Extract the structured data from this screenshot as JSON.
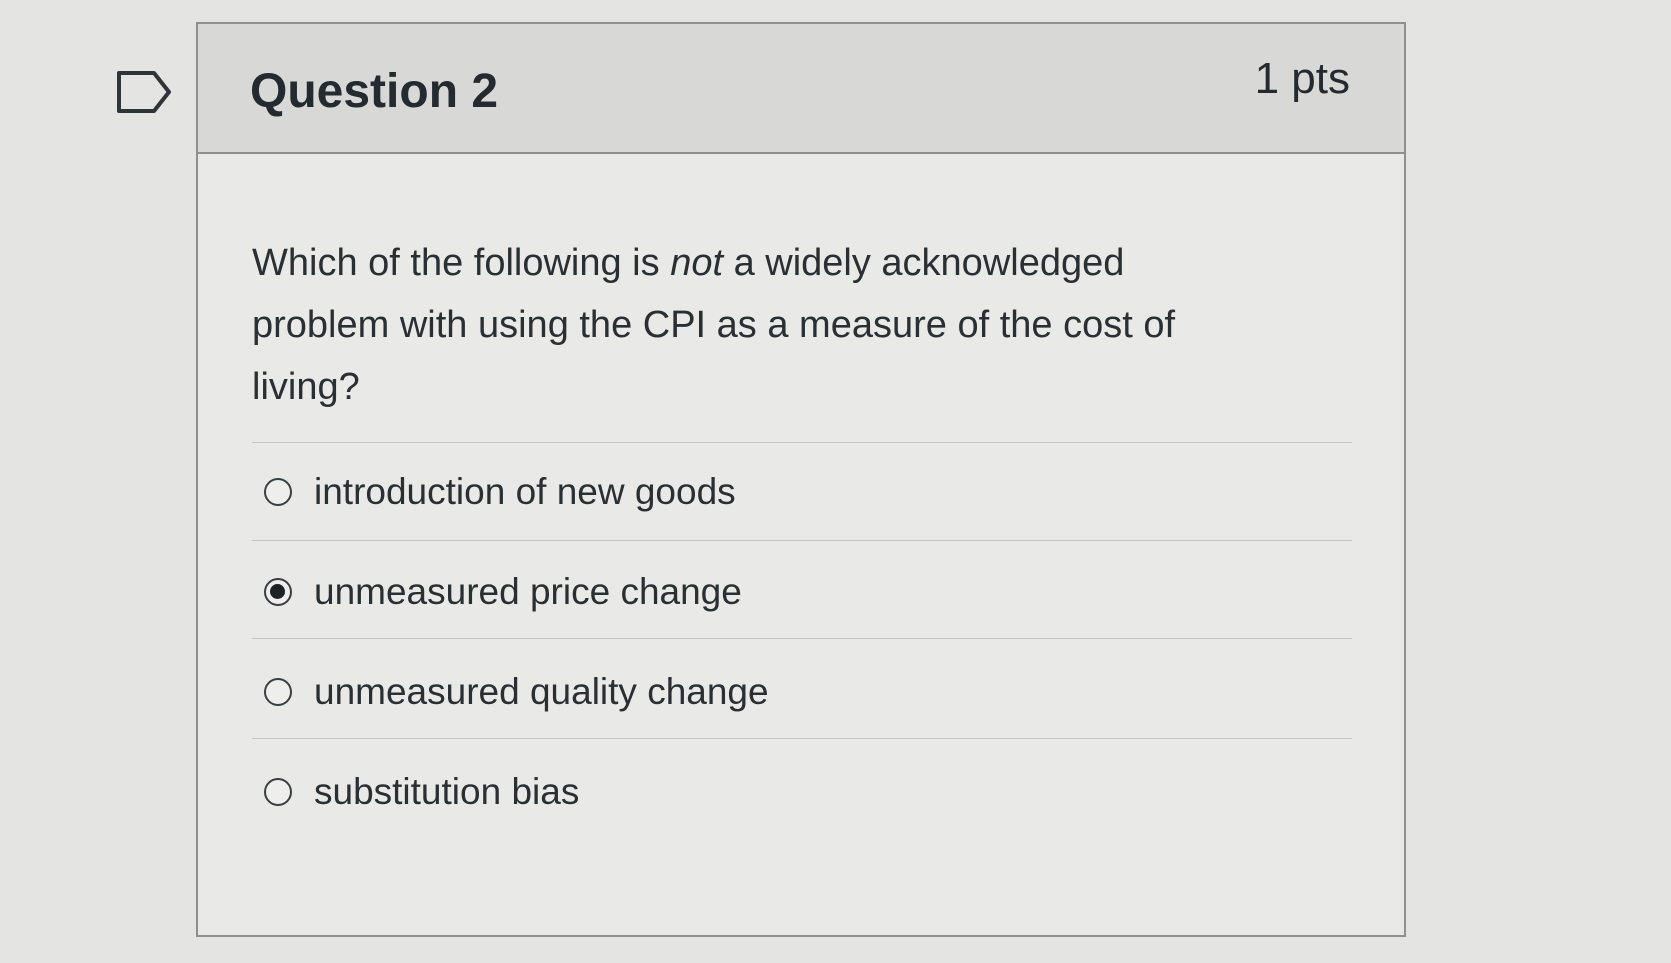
{
  "question": {
    "title": "Question 2",
    "points": "1 pts",
    "text_before": "Which of the following is ",
    "text_emphasis": "not",
    "text_after": " a widely acknowledged problem with using the CPI as a measure of the cost of living?"
  },
  "answers": [
    {
      "label": "introduction of new goods",
      "selected": false
    },
    {
      "label": "unmeasured price change",
      "selected": true
    },
    {
      "label": "unmeasured quality change",
      "selected": false
    },
    {
      "label": "substitution bias",
      "selected": false
    }
  ],
  "flag": {
    "icon": "bookmark-flag-icon"
  }
}
